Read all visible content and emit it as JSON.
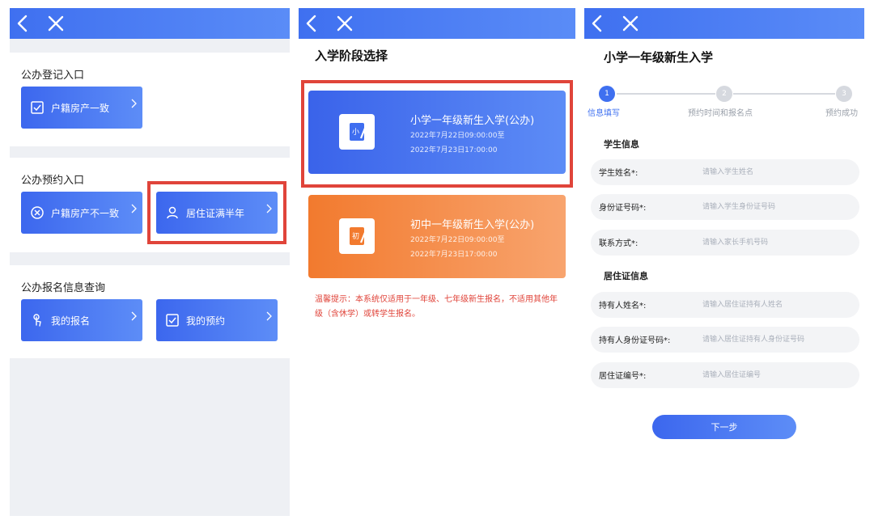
{
  "panel1": {
    "registration": {
      "title": "公办登记入口",
      "items": [
        {
          "label": "户籍房产一致",
          "icon": "checkbox-icon"
        }
      ]
    },
    "appointment": {
      "title": "公办预约入口",
      "items": [
        {
          "label": "户籍房产不一致",
          "icon": "x-circle-icon"
        },
        {
          "label": "居住证满半年",
          "icon": "user-icon"
        }
      ]
    },
    "query": {
      "title": "公办报名信息查询",
      "items": [
        {
          "label": "我的报名",
          "icon": "hand-pointer-icon"
        },
        {
          "label": "我的预约",
          "icon": "checkbox-icon"
        }
      ]
    }
  },
  "panel2": {
    "title": "入学阶段选择",
    "stages": [
      {
        "name": "小学一年级新生入学(公办)",
        "start": "2022年7月22日09:00:00至",
        "end": "2022年7月23日17:00:00",
        "color": "#3a63ea",
        "icon_text": "小"
      },
      {
        "name": "初中一年级新生入学(公办)",
        "start": "2022年7月22日09:00:00至",
        "end": "2022年7月23日17:00:00",
        "color": "#f27a2e",
        "icon_text": "初"
      }
    ],
    "tip": "温馨提示：本系统仅适用于一年级、七年级新生报名，不适用其他年级（含休学）或转学生报名。"
  },
  "panel3": {
    "title": "小学一年级新生入学",
    "steps": [
      {
        "num": "1",
        "label": "信息填写",
        "active": true
      },
      {
        "num": "2",
        "label": "预约时间和报名点",
        "active": false
      },
      {
        "num": "3",
        "label": "预约成功",
        "active": false
      }
    ],
    "student_section": "学生信息",
    "student_fields": [
      {
        "label": "学生姓名",
        "required": "*:",
        "placeholder": "请输入学生姓名"
      },
      {
        "label": "身份证号码",
        "required": "*:",
        "placeholder": "请输入学生身份证号码"
      },
      {
        "label": "联系方式",
        "required": "*:",
        "placeholder": "请输入家长手机号码"
      }
    ],
    "residence_section": "居住证信息",
    "residence_fields": [
      {
        "label": "持有人姓名",
        "required": "*:",
        "placeholder": "请输入居住证持有人姓名"
      },
      {
        "label": "持有人身份证号码",
        "required": "*:",
        "placeholder": "请输入居住证持有人身份证号码"
      },
      {
        "label": "居住证编号",
        "required": "*:",
        "placeholder": "请输入居住证编号"
      }
    ],
    "next_label": "下一步"
  },
  "colors": {
    "accent_blue": "#3f70f0",
    "accent_orange": "#f27a2e",
    "highlight_red": "#e0443a",
    "step_inactive": "#d6d9df"
  }
}
